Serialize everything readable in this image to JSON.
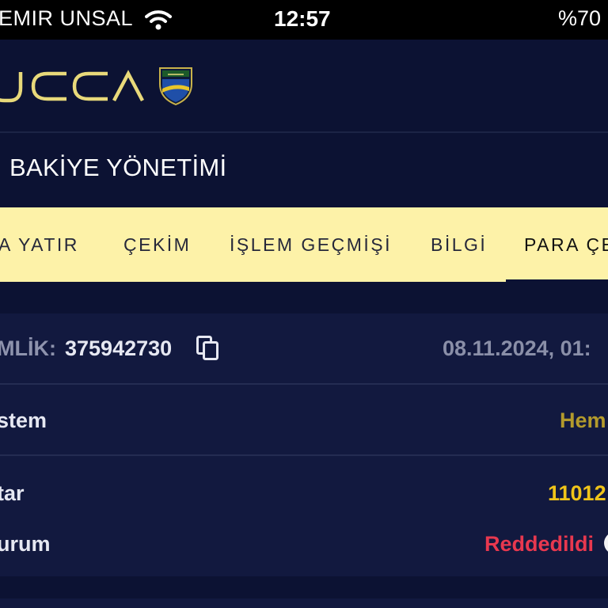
{
  "status_bar": {
    "carrier": "EMIR UNSAL",
    "time": "12:57",
    "battery": "%70"
  },
  "brand": {
    "logo_text": "UCCA",
    "logo_color": "#e8d97a",
    "emblem_icon": "club-shield-emblem"
  },
  "page": {
    "title": "BAKİYE YÖNETİMİ"
  },
  "tabs": [
    {
      "label": "A YATIR",
      "active": false
    },
    {
      "label": "ÇEKİM",
      "active": false
    },
    {
      "label": "İŞLEM GEÇMİŞİ",
      "active": false
    },
    {
      "label": "BİLGİ",
      "active": false
    },
    {
      "label": "PARA ÇE",
      "active": true
    }
  ],
  "transaction": {
    "id_label": "MLİK:",
    "id_value": "375942730",
    "date": "08.11.2024, 01:",
    "rows": [
      {
        "label": "stem",
        "value": "Hem",
        "value_color": "#b39a2c"
      },
      {
        "label": "tar",
        "value": "11012",
        "value_color": "#f0c419"
      },
      {
        "label": "urum",
        "value": "Reddedildi",
        "value_color": "#e8384f"
      }
    ]
  },
  "colors": {
    "background": "#0c1233",
    "card": "#12193f",
    "tab_bar": "#fdf2a8",
    "status_rejected": "#e8384f",
    "amount": "#f0c419"
  }
}
